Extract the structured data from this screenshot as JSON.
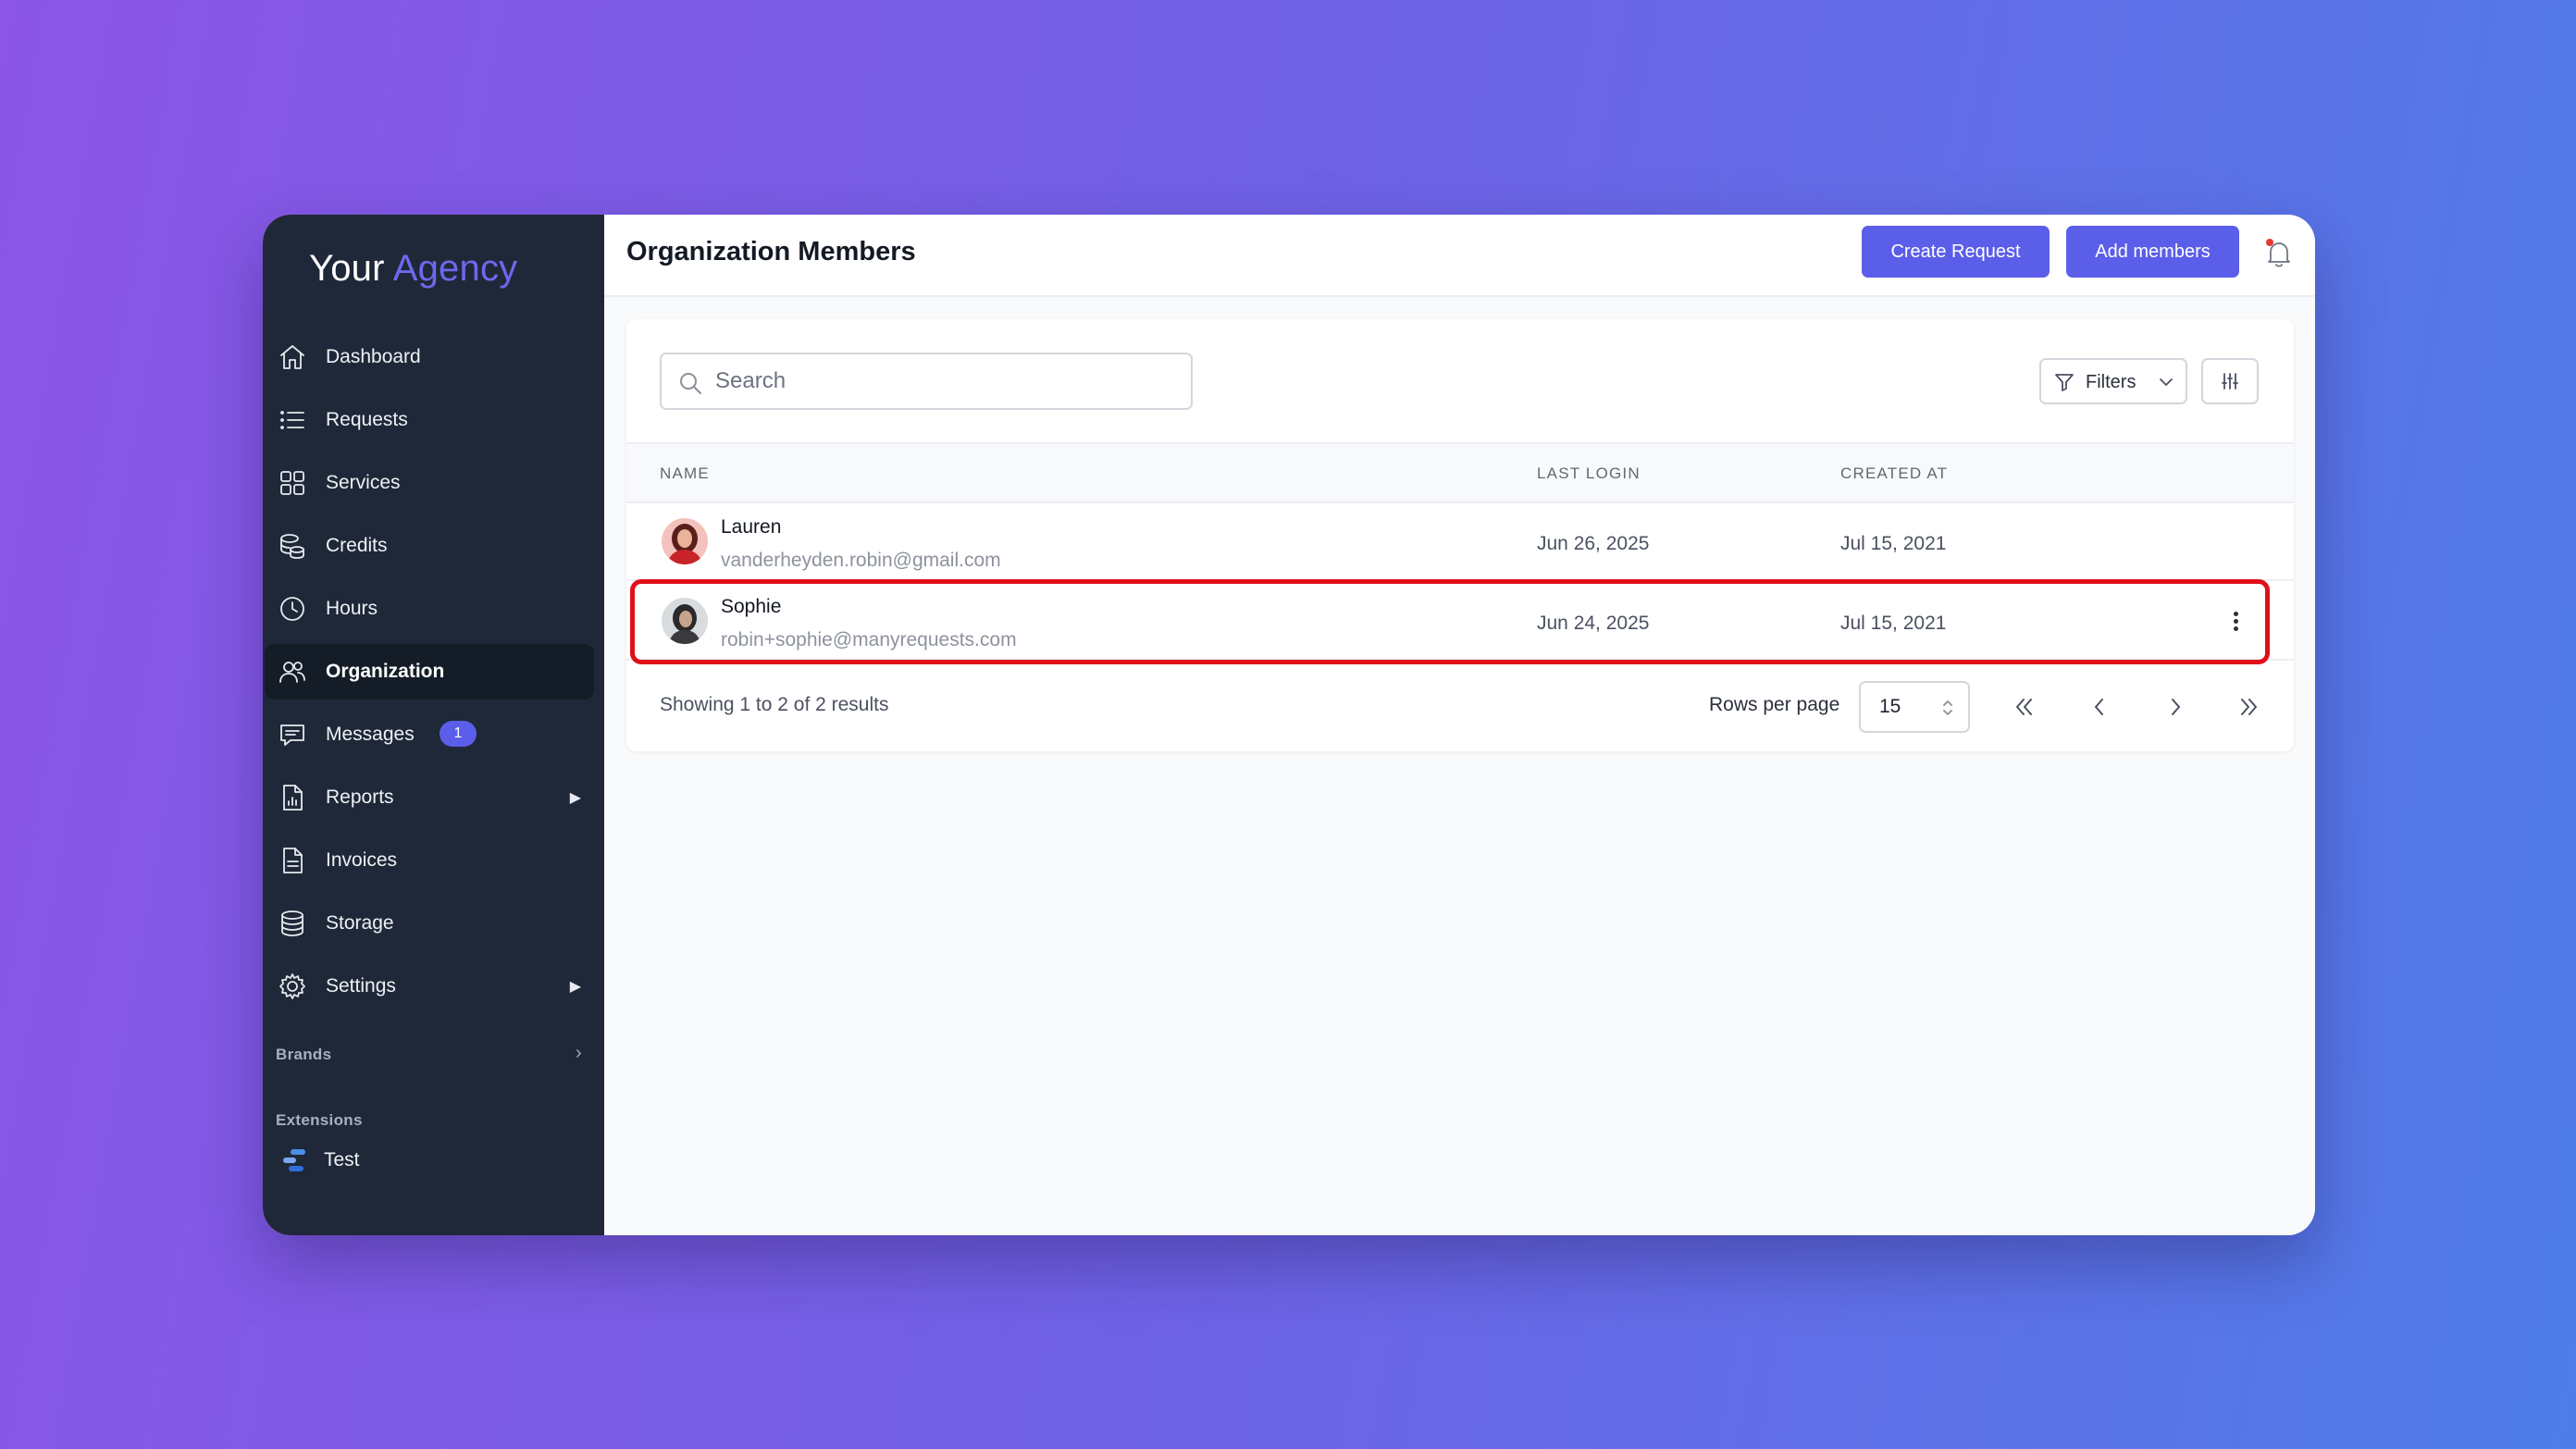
{
  "brand": {
    "word1": "Your",
    "word2": "Agency",
    "accent_color": "#6d68ee"
  },
  "sidebar": {
    "items": [
      {
        "label": "Dashboard",
        "icon": "home-icon"
      },
      {
        "label": "Requests",
        "icon": "list-icon"
      },
      {
        "label": "Services",
        "icon": "grid-icon"
      },
      {
        "label": "Credits",
        "icon": "coins-icon"
      },
      {
        "label": "Hours",
        "icon": "clock-icon"
      },
      {
        "label": "Organization",
        "icon": "users-icon",
        "active": true
      },
      {
        "label": "Messages",
        "icon": "chat-icon",
        "badge": "1"
      },
      {
        "label": "Reports",
        "icon": "report-icon",
        "expandable": true
      },
      {
        "label": "Invoices",
        "icon": "document-icon"
      },
      {
        "label": "Storage",
        "icon": "database-icon"
      },
      {
        "label": "Settings",
        "icon": "gear-icon",
        "expandable": true
      }
    ],
    "brands_label": "Brands",
    "extensions_label": "Extensions",
    "extensions": [
      {
        "label": "Test",
        "icon": "extension-icon"
      }
    ]
  },
  "header": {
    "title": "Organization Members",
    "create_request_label": "Create Request",
    "add_members_label": "Add members",
    "primary_color": "#5b5ee8"
  },
  "toolbar": {
    "search_placeholder": "Search",
    "filters_label": "Filters"
  },
  "table": {
    "columns": [
      "NAME",
      "LAST LOGIN",
      "CREATED AT"
    ],
    "rows": [
      {
        "name": "Lauren",
        "email": "vanderheyden.robin@gmail.com",
        "last_login": "Jun 26, 2025",
        "created_at": "Jul 15, 2021"
      },
      {
        "name": "Sophie",
        "email": "robin+sophie@manyrequests.com",
        "last_login": "Jun 24, 2025",
        "created_at": "Jul 15, 2021",
        "highlighted": true
      }
    ]
  },
  "footer": {
    "showing_text": "Showing 1 to 2 of 2 results",
    "rows_per_page_label": "Rows per page",
    "rows_per_page_value": "15"
  },
  "highlight_color": "#e0101b"
}
